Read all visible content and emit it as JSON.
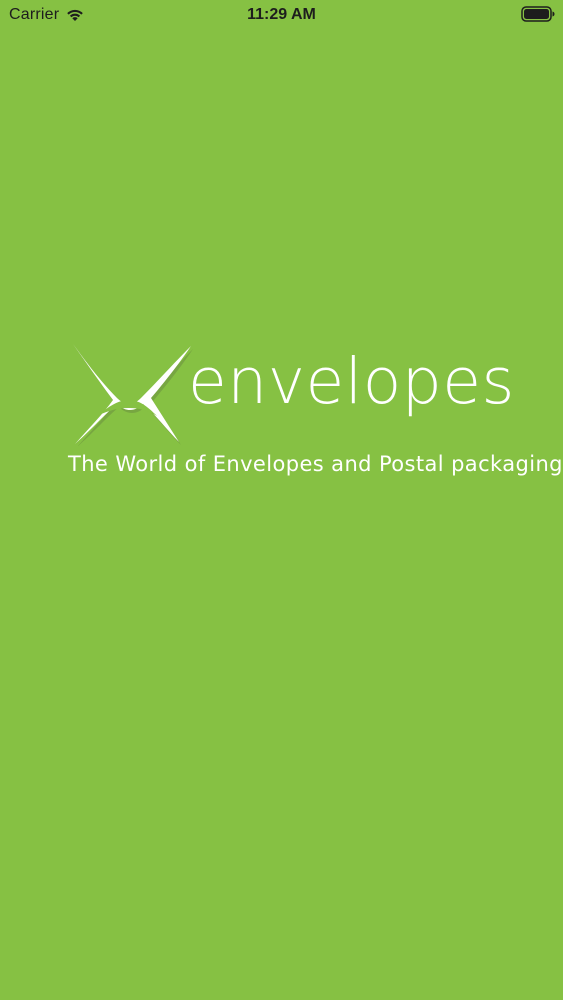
{
  "status_bar": {
    "carrier": "Carrier",
    "time": "11:29 AM",
    "icons": [
      "wifi-icon",
      "battery-icon"
    ]
  },
  "splash": {
    "background_color": "#86c143",
    "logo_icon": "envelope-m-logo-icon",
    "brand_name": "envelopes",
    "tagline": "The World of Envelopes and Postal packaging"
  }
}
